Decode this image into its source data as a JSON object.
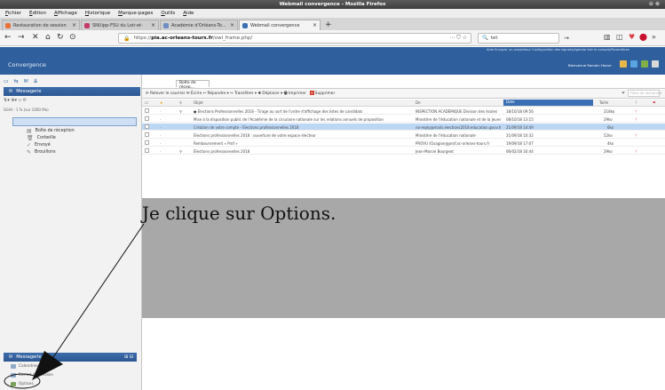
{
  "window": {
    "title": "Webmail convergence - Mozilla Firefox",
    "controls": "⊖ ⊗"
  },
  "menubar": [
    "Fichier",
    "Édition",
    "Affichage",
    "Historique",
    "Marque-pages",
    "Outils",
    "Aide"
  ],
  "tabs": [
    {
      "label": "Restauration de session",
      "favicon_color": "#e8703a",
      "active": false
    },
    {
      "label": "SNUipp-FSU du Loir-et-",
      "favicon_color": "#c63a6a",
      "active": false
    },
    {
      "label": "Académie d'Orléans-To...",
      "favicon_color": "#6d8ec4",
      "active": false
    },
    {
      "label": "Webmail convergence",
      "favicon_color": "#3b6fb3",
      "active": true
    }
  ],
  "navbar": {
    "back": "←",
    "forward": "→",
    "stop": "✕",
    "home": "⌂",
    "reload": "↻",
    "bookmark_star": "☆",
    "readinglist": "⊙",
    "url_prefix": "https://",
    "url_host": "pia.ac-orleans-tours.fr",
    "url_path": "/owi_frame.php/",
    "page_actions": "⋯ ⛉ ☆",
    "search_text": "tet",
    "search_go": "→",
    "toolbar_icons": [
      "library-icon",
      "sidebar-icon",
      "pocket-icon",
      "adblock-icon",
      "overflow-icon"
    ]
  },
  "app": {
    "toplinks": "Aide  Envoyer un avis/retour  Configuration des signets/Agenda  Voir le compte/Paramètres",
    "brand": "Convergence",
    "user": "Bienvenue Romain Heyse",
    "quickbuttons": [
      "#e8b84a",
      "#5aa4e0",
      "#7fb04a",
      "#d9d9d9"
    ]
  },
  "left": {
    "toolbar_icons": "▭ ⇆ ✉ ⇊",
    "header": "Messagerie",
    "mini_tools": "⇅▾ ⊕▾ ⬦ ⟳",
    "account": "SGHI - 1 % (sur 1000 Mo)",
    "folders": [
      {
        "icon": "inbox-icon",
        "label": "Boîte de réception"
      },
      {
        "icon": "drafts-icon",
        "label": "Corbeille"
      },
      {
        "icon": "sent-icon",
        "label": "Envoyé"
      },
      {
        "icon": "draft-icon",
        "label": "Brouillons"
      }
    ],
    "bottom_header": "Messagerie",
    "bottom_header_buttons": "⊞ ⊟",
    "bottom_nav": [
      "Calendrier",
      "Carnet d'adresses",
      "Options"
    ]
  },
  "main": {
    "tab_label": "Boîte de récep...",
    "toolbar": "⟳ Relever le courrier   ✉ Écrire   ↩ Répondre ▾   ↪ Transférer ▾   ✱ Déplacer ▾   🖶 Imprimer",
    "delete_label": "Supprimer",
    "filter_placeholder": "Filtre de recherche",
    "columns": {
      "subject": "Objet",
      "from": "De",
      "date": "Date",
      "size": "Taille"
    },
    "messages": [
      {
        "subject": "● Élections Professionnelles 2018 - Tirage au sort de l'ordre d'affichage des listes de candidats",
        "from": "INSPECTION ACADÉMIQUE Division des écoles",
        "date": "18/10/18 09:56",
        "size": "218ko",
        "flag": "!",
        "selected": false
      },
      {
        "subject": "Mise à la disposition public de l'Académie de la circulaire nationale sur les relations annuels de proposition",
        "from": "Ministère de l'éducation nationale et de la jeunesse",
        "date": "08/10/18 13:15",
        "size": "29ko",
        "flag": "!",
        "selected": false
      },
      {
        "subject": "Création de votre compte - Élections professionnelles 2018",
        "from": "no-reply@mails.elections2018.education.gouv.fr",
        "date": "21/09/18 14:49",
        "size": "6ko",
        "flag": "",
        "selected": true
      },
      {
        "subject": "Élections professionnelles 2018 : ouverture de votre espace électeur",
        "from": "Ministère de l'éducation nationale",
        "date": "21/09/18 10:32",
        "size": "52ko",
        "flag": "!",
        "selected": false
      },
      {
        "subject": "Remboursement « Prof »",
        "from": "PROVU 41sagion@prof.ac-orleans-tours.fr",
        "date": "19/09/18 17:07",
        "size": "4ko",
        "flag": "",
        "selected": false
      },
      {
        "subject": "Élections professionnelles 2018",
        "from": "Jean-Marcel Bourgeot",
        "date": "06/02/18 16:44",
        "size": "29ko",
        "flag": "!",
        "selected": false
      }
    ]
  },
  "annotation": {
    "caption": "Je clique sur Options."
  }
}
